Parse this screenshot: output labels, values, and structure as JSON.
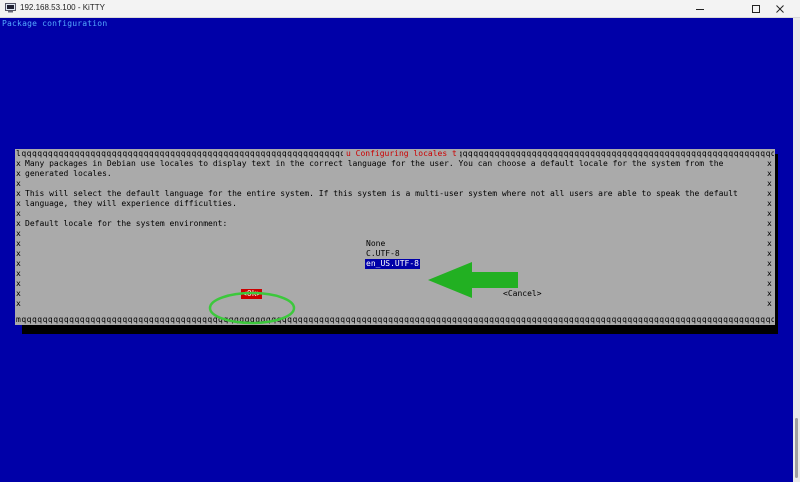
{
  "window": {
    "title": "192.168.53.100 - KiTTY",
    "minimize_glyph": "—",
    "maximize_glyph": "☐",
    "close_glyph": "✕"
  },
  "terminal": {
    "header": "Package configuration"
  },
  "dialog": {
    "top_border": "lqqqqqqqqqqqqqqqqqqqqqqqqqqqqqqqqqqqqqqqqqqqqqqqqqqqqqqqqqqqqqqqqqqqqqqqqqqqqqqqqqqqqqqqqqqqqqqqqqqqqqqqqqqqqqqqqqqqqqqqqqqqqqqqqqqqqqqqqqqqqqqqqqqqqqqqqqqqqqqqqqqqqqqqqqqk",
    "title": "u Configuring locales t",
    "bottom_border": "mqqqqqqqqqqqqqqqqqqqqqqqqqqqqqqqqqqqqqqqqqqqqqqqqqqqqqqqqqqqqqqqqqqqqqqqqqqqqqqqqqqqqqqqqqqqqqqqqqqqqqqqqqqqqqqqqqqqqqqqqqqqqqqqqqqqqqqqqqqqqqqqqqqqqqqqqqqqqqqqqqqqqqqqqqqj",
    "side_char": "x",
    "paragraph1_line1": "Many packages in Debian use locales to display text in the correct language for the user. You can choose a default locale for the system from the",
    "paragraph1_line2": "generated locales.",
    "paragraph2_line1": "This will select the default language for the entire system. If this system is a multi-user system where not all users are able to speak the default",
    "paragraph2_line2": "language, they will experience difficulties.",
    "prompt": "Default locale for the system environment:",
    "options": [
      "None",
      "C.UTF-8",
      "en_US.UTF-8"
    ],
    "selected_option": "en_US.UTF-8",
    "ok_label": "<Ok>",
    "cancel_label": "<Cancel>"
  },
  "colors": {
    "terminal_bg": "#0000a8",
    "dialog_bg": "#aaaaaa",
    "title_red": "#cc0000",
    "header_blue": "#55aaff",
    "annotation_green": "#22b022"
  }
}
